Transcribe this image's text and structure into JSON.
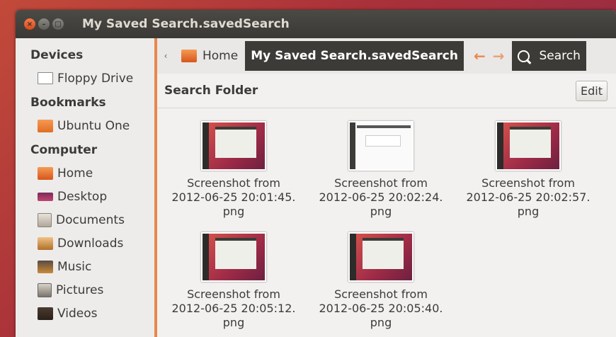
{
  "window": {
    "title": "My Saved Search.savedSearch",
    "buttons": {
      "close": "×",
      "minimize": "–",
      "maximize": "□"
    }
  },
  "sidebar": {
    "sections": [
      {
        "header": "Devices",
        "items": [
          {
            "label": "Floppy Drive",
            "icon": "floppy-icon"
          }
        ]
      },
      {
        "header": "Bookmarks",
        "items": [
          {
            "label": "Ubuntu One",
            "icon": "folder-icon"
          }
        ]
      },
      {
        "header": "Computer",
        "items": [
          {
            "label": "Home",
            "icon": "home-folder-icon"
          },
          {
            "label": "Desktop",
            "icon": "desktop-icon"
          },
          {
            "label": "Documents",
            "icon": "documents-icon"
          },
          {
            "label": "Downloads",
            "icon": "downloads-icon"
          },
          {
            "label": "Music",
            "icon": "music-icon"
          },
          {
            "label": "Pictures",
            "icon": "pictures-icon"
          },
          {
            "label": "Videos",
            "icon": "videos-icon"
          }
        ]
      }
    ]
  },
  "toolbar": {
    "nav_left": "‹",
    "breadcrumb_home": "Home",
    "breadcrumb_current": "My Saved Search.savedSearch",
    "back_arrow": "←",
    "forward_arrow": "→",
    "search_label": "Search"
  },
  "searchbar": {
    "label": "Search Folder",
    "edit_label": "Edit"
  },
  "files": [
    {
      "line1": "Screenshot from",
      "line2": "2012-06-25 20:01:45.",
      "line3": "png"
    },
    {
      "line1": "Screenshot from",
      "line2": "2012-06-25 20:02:24.",
      "line3": "png"
    },
    {
      "line1": "Screenshot from",
      "line2": "2012-06-25 20:02:57.",
      "line3": "png"
    },
    {
      "line1": "Screenshot from",
      "line2": "2012-06-25 20:05:12.",
      "line3": "png"
    },
    {
      "line1": "Screenshot from",
      "line2": "2012-06-25 20:05:40.",
      "line3": "png"
    }
  ],
  "colors": {
    "accent": "#e8874d",
    "titlebar": "#3c3b37"
  }
}
